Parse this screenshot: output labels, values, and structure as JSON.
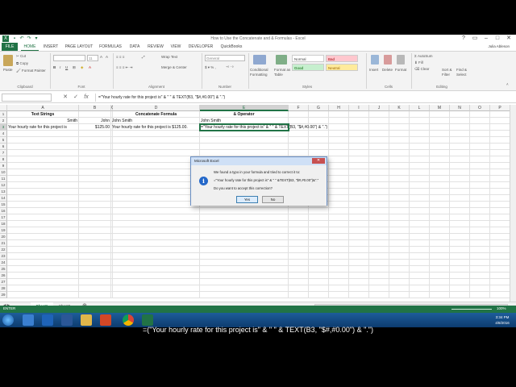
{
  "window": {
    "title": "How to Use the Concatenate and & Formulas - Excel",
    "user": "Julia Ableson"
  },
  "tabs": [
    "FILE",
    "HOME",
    "INSERT",
    "PAGE LAYOUT",
    "FORMULAS",
    "DATA",
    "REVIEW",
    "VIEW",
    "DEVELOPER",
    "QuickBooks"
  ],
  "ribbon": {
    "paste": "Paste",
    "cut": "Cut",
    "copy": "Copy",
    "format_painter": "Format Painter",
    "clipboard": "Clipboard",
    "font_size": "11",
    "font": "Font",
    "wrap_text": "Wrap Text",
    "merge_center": "Merge & Center",
    "alignment": "Alignment",
    "number_format": "General",
    "number": "Number",
    "conditional_formatting": "Conditional Formatting",
    "format_as_table": "Format as Table",
    "style_normal": "Normal",
    "style_bad": "Bad",
    "style_good": "Good",
    "style_neutral": "Neutral",
    "styles": "Styles",
    "insert": "Insert",
    "delete": "Delete",
    "format": "Format",
    "cells": "Cells",
    "autosum": "AutoSum",
    "fill": "Fill",
    "clear": "Clear",
    "sort_filter": "Sort & Filter",
    "find_select": "Find & Select",
    "editing": "Editing"
  },
  "formula_bar": {
    "fx": "fx",
    "content": "=\"Your hourly rate for this project is\" & \" \" & TEXT(B3, \"$#,#0.00\") & \".\")"
  },
  "columns": [
    "A",
    "B",
    "C",
    "D",
    "E",
    "F",
    "G",
    "H",
    "I",
    "J",
    "K",
    "L",
    "M",
    "N",
    "O",
    "P"
  ],
  "rows": [
    "1",
    "2",
    "3",
    "4",
    "5",
    "6",
    "7",
    "8",
    "9",
    "10",
    "11",
    "12",
    "13",
    "14",
    "15",
    "16",
    "17",
    "18",
    "19",
    "20",
    "21",
    "22",
    "23",
    "24",
    "25",
    "26",
    "27",
    "28",
    "29"
  ],
  "cells": {
    "a1": "Text Strings",
    "d1": "Concatenate Formula",
    "e1": "& Operator",
    "a2": "Smith",
    "b2": "John",
    "c2": "John Smith",
    "e2": "John Smith",
    "a3": "Your hourly rate for this project is",
    "b3": "$125.00",
    "c3": "Your hourly rate for this project is $125.00.",
    "e3": "=\"Your hourly rate for this project is\" & \" \" & TEXT(B3, \"$#,#0.00\") & \".\")"
  },
  "sheets": [
    "Sheet1",
    "Sheet2"
  ],
  "status": {
    "mode": "ENTER",
    "zoom": "100%"
  },
  "dialog": {
    "title": "Microsoft Excel",
    "line1": "We found a typo in your formula and tried to correct it to:",
    "line2": "=\"Your hourly rate for this project is\" & \" \" &TEXT(B3, \"$#,#0.00\")&\".\"",
    "line3": "Do you want to accept this correction?",
    "yes": "Yes",
    "no": "No"
  },
  "taskbar": {
    "time": "3:34 PM",
    "date": "4/8/2016"
  },
  "caption": "=(\"Your hourly rate for this project is\" & \" \" & TEXT(B3, \"$#,#0.00\") & \".\")",
  "colors": {
    "excel_green": "#217346",
    "dialog_title": "#cfe0f6",
    "taskbar": "#1d5d9a"
  }
}
